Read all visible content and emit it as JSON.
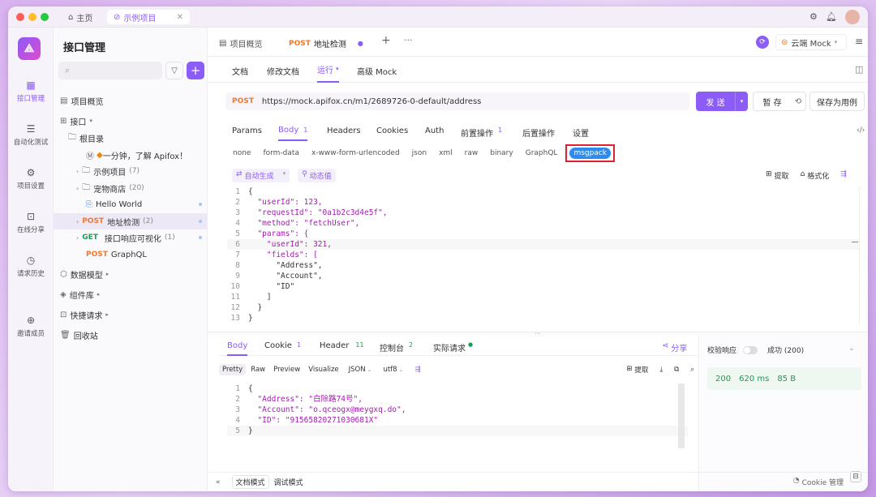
{
  "titlebar": {
    "tab_home": "主页",
    "tab_project": "示例项目"
  },
  "leftnav": {
    "items": [
      {
        "label": "接口管理",
        "icon": "api-management-icon",
        "active": true
      },
      {
        "label": "自动化测试",
        "icon": "automation-icon",
        "active": false
      },
      {
        "label": "项目设置",
        "icon": "settings-icon",
        "active": false
      },
      {
        "label": "在线分享",
        "icon": "share-icon",
        "active": false
      },
      {
        "label": "请求历史",
        "icon": "history-icon",
        "active": false
      },
      {
        "label": "邀请成员",
        "icon": "invite-icon",
        "active": false
      }
    ]
  },
  "tree": {
    "title": "接口管理",
    "search_placeholder": "",
    "overview": "项目概览",
    "api": "接口",
    "root": "根目录",
    "intro": "一分钟，了解 Apifox！",
    "example_project": "示例项目",
    "example_count": "(7)",
    "pet_store": "宠物商店",
    "pet_count": "(20)",
    "hello": "Hello World",
    "addr_method": "POST",
    "addr_name": "地址检测",
    "addr_count": "(2)",
    "viz_method": "GET",
    "viz_name": "接口响应可视化",
    "viz_count": "(1)",
    "gql_method": "POST",
    "gql_name": "GraphQL",
    "data_model": "数据模型",
    "components": "组件库",
    "quick_req": "快捷请求",
    "recycle": "回收站"
  },
  "topbar": {
    "overview_tab": "项目概览",
    "active_method": "POST",
    "active_name": "地址检测",
    "env": "云端 Mock"
  },
  "subtabs": {
    "doc": "文档",
    "edit": "修改文档",
    "run": "运行",
    "mock": "高级 Mock"
  },
  "request": {
    "method": "POST",
    "url": "https://mock.apifox.cn/m1/2689726-0-default/address",
    "send": "发 送",
    "save": "暂 存",
    "save_case": "保存为用例"
  },
  "param_tabs": {
    "params": "Params",
    "body": "Body",
    "body_count": "1",
    "headers": "Headers",
    "cookies": "Cookies",
    "auth": "Auth",
    "pre": "前置操作",
    "pre_count": "1",
    "post": "后置操作",
    "settings": "设置"
  },
  "body_types": [
    "none",
    "form-data",
    "x-www-form-urlencoded",
    "json",
    "xml",
    "raw",
    "binary",
    "GraphQL",
    "msgpack"
  ],
  "body_tools": {
    "autogen": "自动生成",
    "dynamic": "动态值",
    "extract": "提取",
    "format": "格式化"
  },
  "request_code": [
    "{",
    "  \"userId\": 123,",
    "  \"requestId\": \"0a1b2c3d4e5f\",",
    "  \"method\": \"fetchUser\",",
    "  \"params\": {",
    "    \"userId\": 321,",
    "    \"fields\": [",
    "      \"Address\",",
    "      \"Account\",",
    "      \"ID\"",
    "    ]",
    "  }",
    "}"
  ],
  "response_tabs": {
    "body": "Body",
    "cookie": "Cookie",
    "cookie_count": "1",
    "header": "Header",
    "header_count": "11",
    "console": "控制台",
    "console_count": "2",
    "actual": "实际请求",
    "share": "分享"
  },
  "response_views": {
    "pretty": "Pretty",
    "raw": "Raw",
    "preview": "Preview",
    "visualize": "Visualize",
    "format": "JSON",
    "encoding": "utf8",
    "extract": "提取"
  },
  "response_code": [
    "{",
    "  \"Address\": \"白除路74号\",",
    "  \"Account\": \"o.qceogx@meygxq.do\",",
    "  \"ID\": \"91565820271030681X\"",
    "}"
  ],
  "validation": {
    "label": "校验响应",
    "status": "成功 (200)",
    "code": "200",
    "time": "620 ms",
    "size": "85 B"
  },
  "bottom": {
    "doc_mode": "文档模式",
    "debug_mode": "调试模式",
    "cookie_mgmt": "Cookie 管理"
  },
  "colors": {
    "accent": "#8b5cf6",
    "post": "#f5772e",
    "get": "#1a9c55",
    "highlight": "#e0202e"
  }
}
